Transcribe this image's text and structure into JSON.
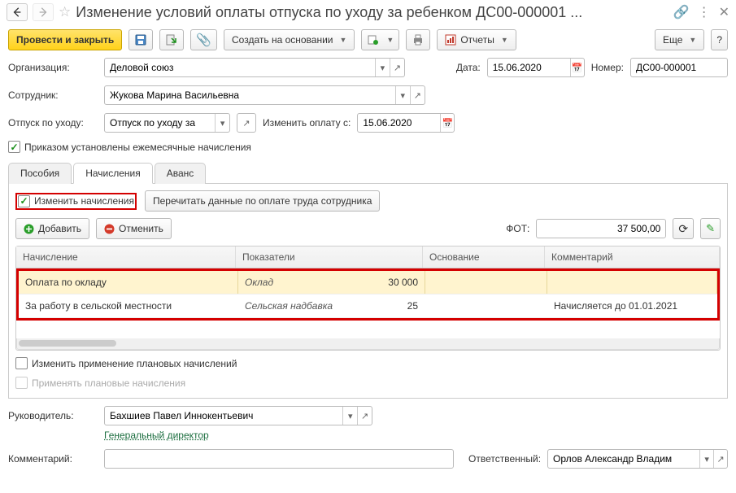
{
  "title": "Изменение условий оплаты отпуска по уходу за ребенком ДС00-000001 ...",
  "toolbar": {
    "post_close": "Провести и закрыть",
    "create_based": "Создать на основании",
    "reports": "Отчеты",
    "more": "Еще"
  },
  "org_label": "Организация:",
  "org_value": "Деловой союз",
  "date_label": "Дата:",
  "date_value": "15.06.2020",
  "num_label": "Номер:",
  "num_value": "ДС00-000001",
  "emp_label": "Сотрудник:",
  "emp_value": "Жукова Марина Васильевна",
  "leave_label": "Отпуск по уходу:",
  "leave_value": "Отпуск по уходу за",
  "change_from_label": "Изменить оплату с:",
  "change_from_value": "15.06.2020",
  "order_check": "Приказом установлены ежемесячные начисления",
  "tabs": {
    "benefits": "Пособия",
    "accruals": "Начисления",
    "advance": "Аванс"
  },
  "panel": {
    "change_accruals": "Изменить начисления",
    "reread_btn": "Перечитать данные по оплате труда сотрудника",
    "add_btn": "Добавить",
    "cancel_btn": "Отменить",
    "fot_label": "ФОТ:",
    "fot_value": "37 500,00",
    "head": {
      "c1": "Начисление",
      "c2": "Показатели",
      "c3": "Основание",
      "c4": "Комментарий"
    },
    "rows": [
      {
        "name": "Оплата по окладу",
        "ind": "Оклад",
        "val": "30 000",
        "base": "",
        "comment": ""
      },
      {
        "name": "За работу в сельской местности",
        "ind": "Сельская надбавка",
        "val": "25",
        "base": "",
        "comment": "Начисляется до 01.01.2021"
      }
    ],
    "change_plan": "Изменить применение плановых начислений",
    "apply_plan": "Применять плановые начисления"
  },
  "manager_label": "Руководитель:",
  "manager_value": "Бахшиев Павел Иннокентьевич",
  "manager_pos": "Генеральный директор",
  "comment_label": "Комментарий:",
  "resp_label": "Ответственный:",
  "resp_value": "Орлов Александр Владим"
}
